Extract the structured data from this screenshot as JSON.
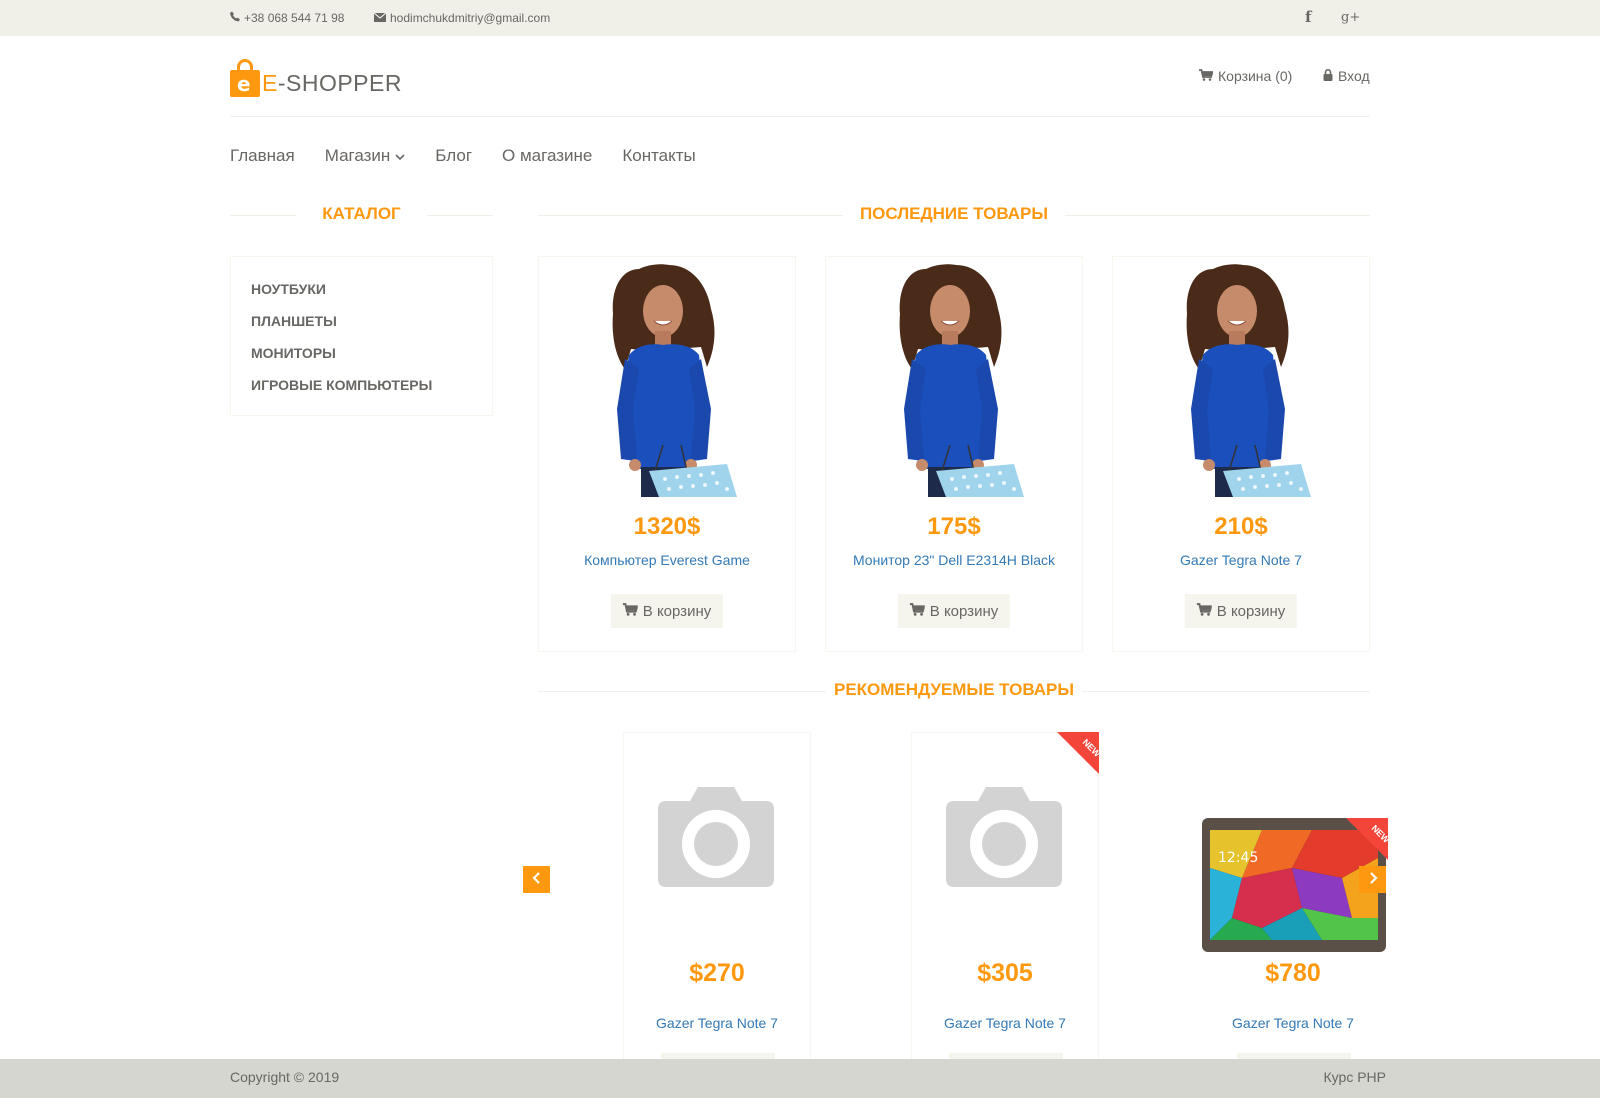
{
  "topbar": {
    "phone": "+38 068 544 71 98",
    "email": "hodimchukdmitriy@gmail.com",
    "social": [
      "f",
      "g+"
    ]
  },
  "header": {
    "logo_e": "e",
    "logo_text_a": "E",
    "logo_text_b": "-SHOPPER",
    "cart_label": "Корзина (0)",
    "login_label": "Вход"
  },
  "nav": {
    "items": [
      "Главная",
      "Магазин",
      "Блог",
      "О магазине",
      "Контакты"
    ]
  },
  "catalog": {
    "title": "КАТАЛОГ",
    "items": [
      "НОУТБУКИ",
      "ПЛАНШЕТЫ",
      "МОНИТОРЫ",
      "ИГРОВЫЕ КОМПЬЮТЕРЫ"
    ]
  },
  "latest": {
    "title": "ПОСЛЕДНИЕ ТОВАРЫ",
    "button_label": "В корзину",
    "products": [
      {
        "price": "1320$",
        "name": "Компьютер Everest Game"
      },
      {
        "price": "175$",
        "name": "Монитор 23\" Dell E2314H Black"
      },
      {
        "price": "210$",
        "name": "Gazer Tegra Note 7"
      }
    ]
  },
  "recommended": {
    "title": "РЕКОМЕНДУЕМЫЕ ТОВАРЫ",
    "badge": "NEW",
    "products": [
      {
        "price": "$270",
        "name": "Gazer Tegra Note 7",
        "is_new": false
      },
      {
        "price": "$305",
        "name": "Gazer Tegra Note 7",
        "is_new": true
      },
      {
        "price": "$780",
        "name": "Gazer Tegra Note 7",
        "is_new": true
      }
    ],
    "tablet_screen_time": "12:45"
  },
  "footer": {
    "copyright": "Copyright © 2019",
    "course": "Курс PHP"
  },
  "colors": {
    "accent": "#fe980f",
    "link": "#337ab7",
    "text": "#696763",
    "topbar_bg": "#f0f0e9",
    "footer_bg": "#d6d6d0",
    "ribbon": "#f3453a"
  }
}
